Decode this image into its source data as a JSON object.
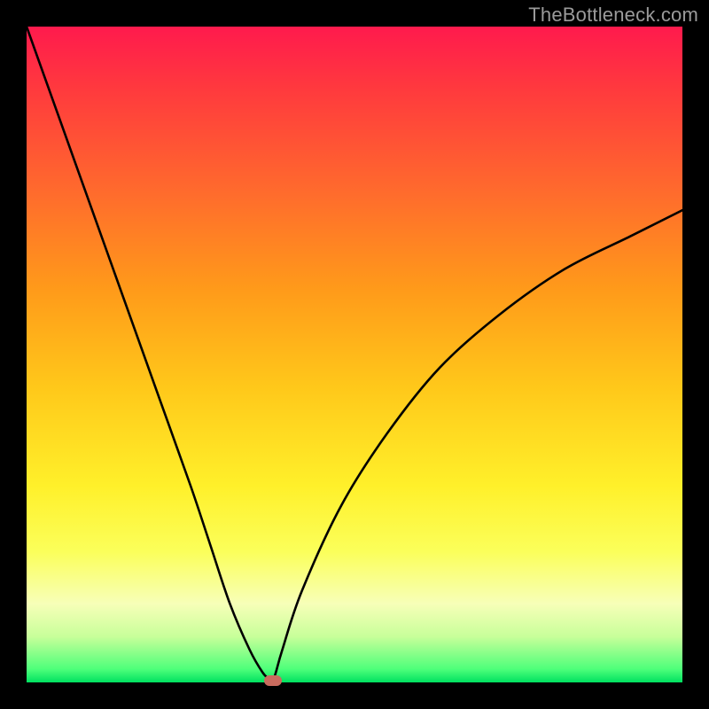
{
  "watermark": {
    "text": "TheBottleneck.com"
  },
  "chart_data": {
    "type": "line",
    "title": "",
    "xlabel": "",
    "ylabel": "",
    "xlim": [
      0,
      100
    ],
    "ylim": [
      0,
      100
    ],
    "series": [
      {
        "name": "bottleneck-curve",
        "x": [
          0,
          5,
          10,
          15,
          20,
          25,
          28,
          31,
          34,
          36,
          37,
          37.5,
          38,
          39,
          42,
          48,
          55,
          63,
          72,
          82,
          92,
          100
        ],
        "values": [
          100,
          86,
          72,
          58,
          44,
          30,
          21,
          12,
          5,
          1.5,
          0.5,
          0,
          1.5,
          5,
          14,
          27,
          38,
          48,
          56,
          63,
          68,
          72
        ]
      }
    ],
    "marker": {
      "name": "optimal-point",
      "x": 37.5,
      "y": 0,
      "color": "#c96b5e"
    },
    "background_gradient": {
      "stops": [
        {
          "pos": 0,
          "color": "#ff1a4d"
        },
        {
          "pos": 25,
          "color": "#ff6a2d"
        },
        {
          "pos": 55,
          "color": "#ffc81a"
        },
        {
          "pos": 80,
          "color": "#fbff5a"
        },
        {
          "pos": 100,
          "color": "#00e060"
        }
      ]
    }
  }
}
